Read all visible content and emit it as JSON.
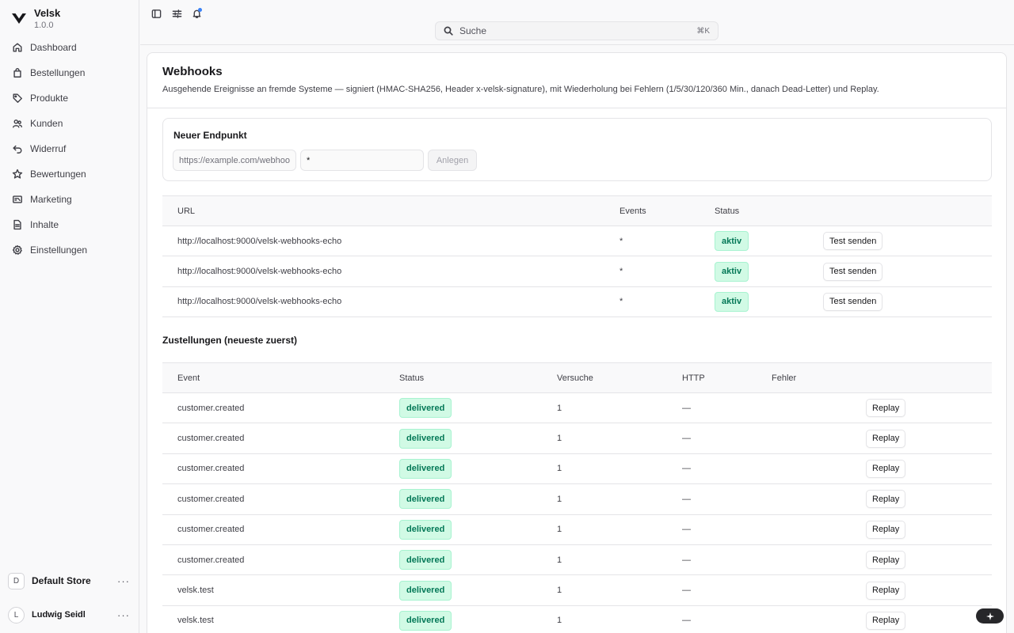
{
  "app": {
    "name": "Velsk",
    "version": "1.0.0"
  },
  "sidebar": {
    "items": [
      {
        "label": "Dashboard",
        "icon": "home-icon"
      },
      {
        "label": "Bestellungen",
        "icon": "shopping-bag-icon"
      },
      {
        "label": "Produkte",
        "icon": "tag-icon"
      },
      {
        "label": "Kunden",
        "icon": "users-icon"
      },
      {
        "label": "Widerruf",
        "icon": "undo-icon"
      },
      {
        "label": "Bewertungen",
        "icon": "star-icon"
      },
      {
        "label": "Marketing",
        "icon": "mail-icon"
      },
      {
        "label": "Inhalte",
        "icon": "file-icon"
      },
      {
        "label": "Einstellungen",
        "icon": "settings-icon"
      }
    ],
    "store": {
      "initial": "D",
      "name": "Default Store"
    },
    "user": {
      "initial": "L",
      "name": "Ludwig Seidl"
    }
  },
  "topbar": {
    "search_label": "Suche",
    "search_shortcut": "⌘K"
  },
  "page": {
    "title": "Webhooks",
    "description": "Ausgehende Ereignisse an fremde Systeme — signiert (HMAC-SHA256, Header x-velsk-signature), mit Wiederholung bei Fehlern (1/5/30/120/360 Min., danach Dead-Letter) und Replay."
  },
  "new_endpoint": {
    "title": "Neuer Endpunkt",
    "url_placeholder": "https://example.com/webhook",
    "events_value": "*",
    "create_label": "Anlegen"
  },
  "endpoints": {
    "headers": {
      "url": "URL",
      "events": "Events",
      "status": "Status"
    },
    "rows": [
      {
        "url": "http://localhost:9000/velsk-webhooks-echo",
        "events": "*",
        "status": "aktiv",
        "action": "Test senden"
      },
      {
        "url": "http://localhost:9000/velsk-webhooks-echo",
        "events": "*",
        "status": "aktiv",
        "action": "Test senden"
      },
      {
        "url": "http://localhost:9000/velsk-webhooks-echo",
        "events": "*",
        "status": "aktiv",
        "action": "Test senden"
      }
    ]
  },
  "deliveries": {
    "title": "Zustellungen (neueste zuerst)",
    "headers": {
      "event": "Event",
      "status": "Status",
      "attempts": "Versuche",
      "http": "HTTP",
      "error": "Fehler"
    },
    "rows": [
      {
        "event": "customer.created",
        "status": "delivered",
        "attempts": "1",
        "http": "—",
        "error": "",
        "action": "Replay"
      },
      {
        "event": "customer.created",
        "status": "delivered",
        "attempts": "1",
        "http": "—",
        "error": "",
        "action": "Replay"
      },
      {
        "event": "customer.created",
        "status": "delivered",
        "attempts": "1",
        "http": "—",
        "error": "",
        "action": "Replay"
      },
      {
        "event": "customer.created",
        "status": "delivered",
        "attempts": "1",
        "http": "—",
        "error": "",
        "action": "Replay"
      },
      {
        "event": "customer.created",
        "status": "delivered",
        "attempts": "1",
        "http": "—",
        "error": "",
        "action": "Replay"
      },
      {
        "event": "customer.created",
        "status": "delivered",
        "attempts": "1",
        "http": "—",
        "error": "",
        "action": "Replay"
      },
      {
        "event": "velsk.test",
        "status": "delivered",
        "attempts": "1",
        "http": "—",
        "error": "",
        "action": "Replay"
      },
      {
        "event": "velsk.test",
        "status": "delivered",
        "attempts": "1",
        "http": "—",
        "error": "",
        "action": "Replay"
      }
    ]
  },
  "colors": {
    "success_bg": "#d1fae5",
    "success_text": "#047857",
    "accent": "#18181b"
  }
}
